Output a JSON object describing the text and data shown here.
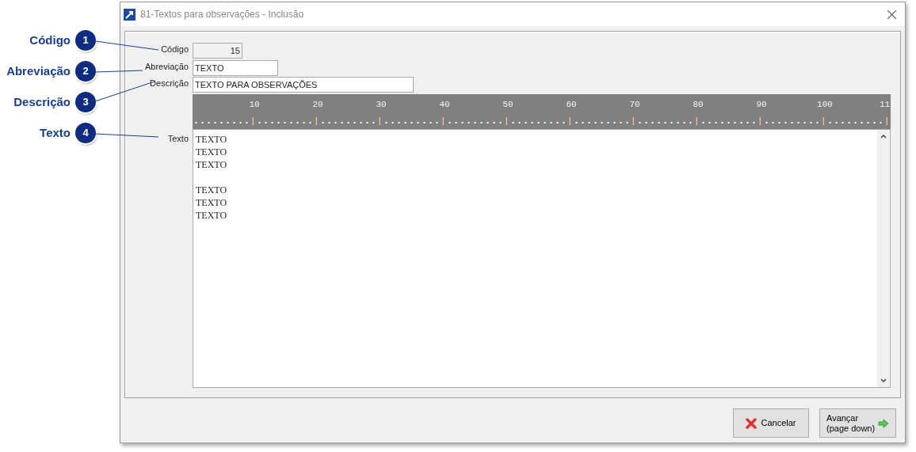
{
  "callouts": [
    {
      "label": "Código",
      "number": "1"
    },
    {
      "label": "Abreviação",
      "number": "2"
    },
    {
      "label": "Descrição",
      "number": "3"
    },
    {
      "label": "Texto",
      "number": "4"
    }
  ],
  "window": {
    "title": "81-Textos para observações - Inclusão"
  },
  "form": {
    "fields": [
      {
        "label": "Código",
        "value": "15",
        "disabled": true,
        "kind": "code"
      },
      {
        "label": "Abreviação",
        "value": "TEXTO",
        "disabled": false,
        "kind": "short"
      },
      {
        "label": "Descrição",
        "value": "TEXTO PARA OBSERVAÇÕES",
        "disabled": false,
        "kind": "long"
      }
    ],
    "text_label": "Texto",
    "ruler": [
      "10",
      "20",
      "30",
      "40",
      "50",
      "60",
      "70",
      "80",
      "90",
      "100",
      "11"
    ],
    "text_paragraphs": [
      [
        "TEXTO",
        "TEXTO",
        "TEXTO"
      ],
      [
        "TEXTO",
        "TEXTO",
        "TEXTO"
      ]
    ]
  },
  "buttons": [
    {
      "label": "Cancelar",
      "kind": "cancel"
    },
    {
      "label": "Avançar",
      "label_line_2": "(page down)",
      "kind": "next"
    }
  ]
}
